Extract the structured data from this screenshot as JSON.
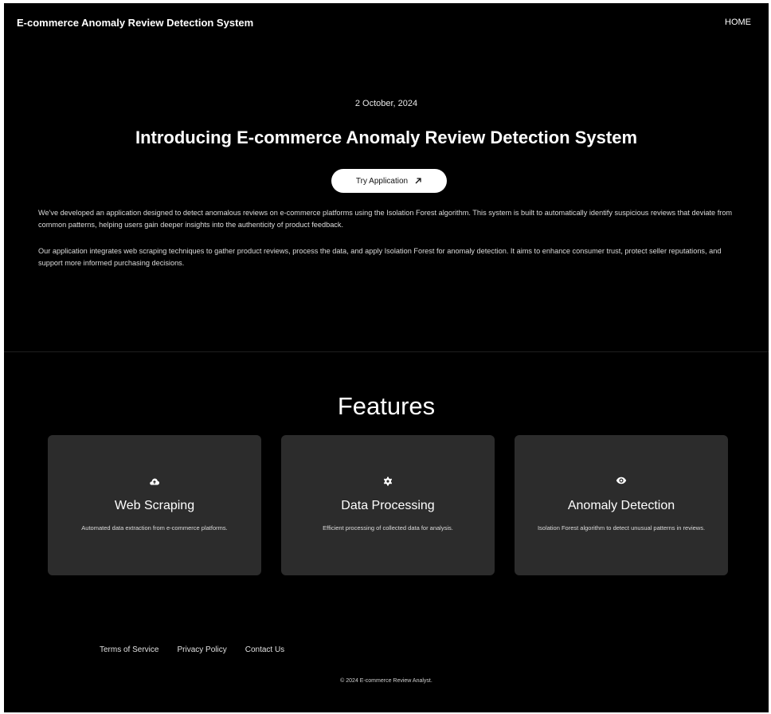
{
  "navbar": {
    "brand": "E-commerce Anomaly Review Detection System",
    "home_link": "HOME"
  },
  "hero": {
    "date": "2 October, 2024",
    "title": "Introducing E-commerce Anomaly Review Detection System",
    "cta_label": "Try Application",
    "cta_icon": "arrow-up-right-icon",
    "paragraphs": [
      "We've developed an application designed to detect anomalous reviews on e-commerce platforms using the Isolation Forest algorithm. This system is built to automatically identify suspicious reviews that deviate from common patterns, helping users gain deeper insights into the authenticity of product feedback.",
      "Our application integrates web scraping techniques to gather product reviews, process the data, and apply Isolation Forest for anomaly detection. It aims to enhance consumer trust, protect seller reputations, and support more informed purchasing decisions."
    ]
  },
  "features": {
    "heading": "Features",
    "cards": [
      {
        "icon": "cloud-upload-icon",
        "title": "Web Scraping",
        "description": "Automated data extraction from e-commerce platforms."
      },
      {
        "icon": "gear-icon",
        "title": "Data Processing",
        "description": "Efficient processing of collected data for analysis."
      },
      {
        "icon": "eye-icon",
        "title": "Anomaly Detection",
        "description": "Isolation Forest algorithm to detect unusual patterns in reviews."
      }
    ]
  },
  "footer": {
    "links": [
      "Terms of Service",
      "Privacy Policy",
      "Contact Us"
    ],
    "copyright": "© 2024 E-commerce Review Analyst."
  },
  "colors": {
    "background": "#000000",
    "card": "#2c2c2c",
    "text": "#ffffff",
    "button_bg": "#ffffff",
    "button_text": "#111111"
  }
}
